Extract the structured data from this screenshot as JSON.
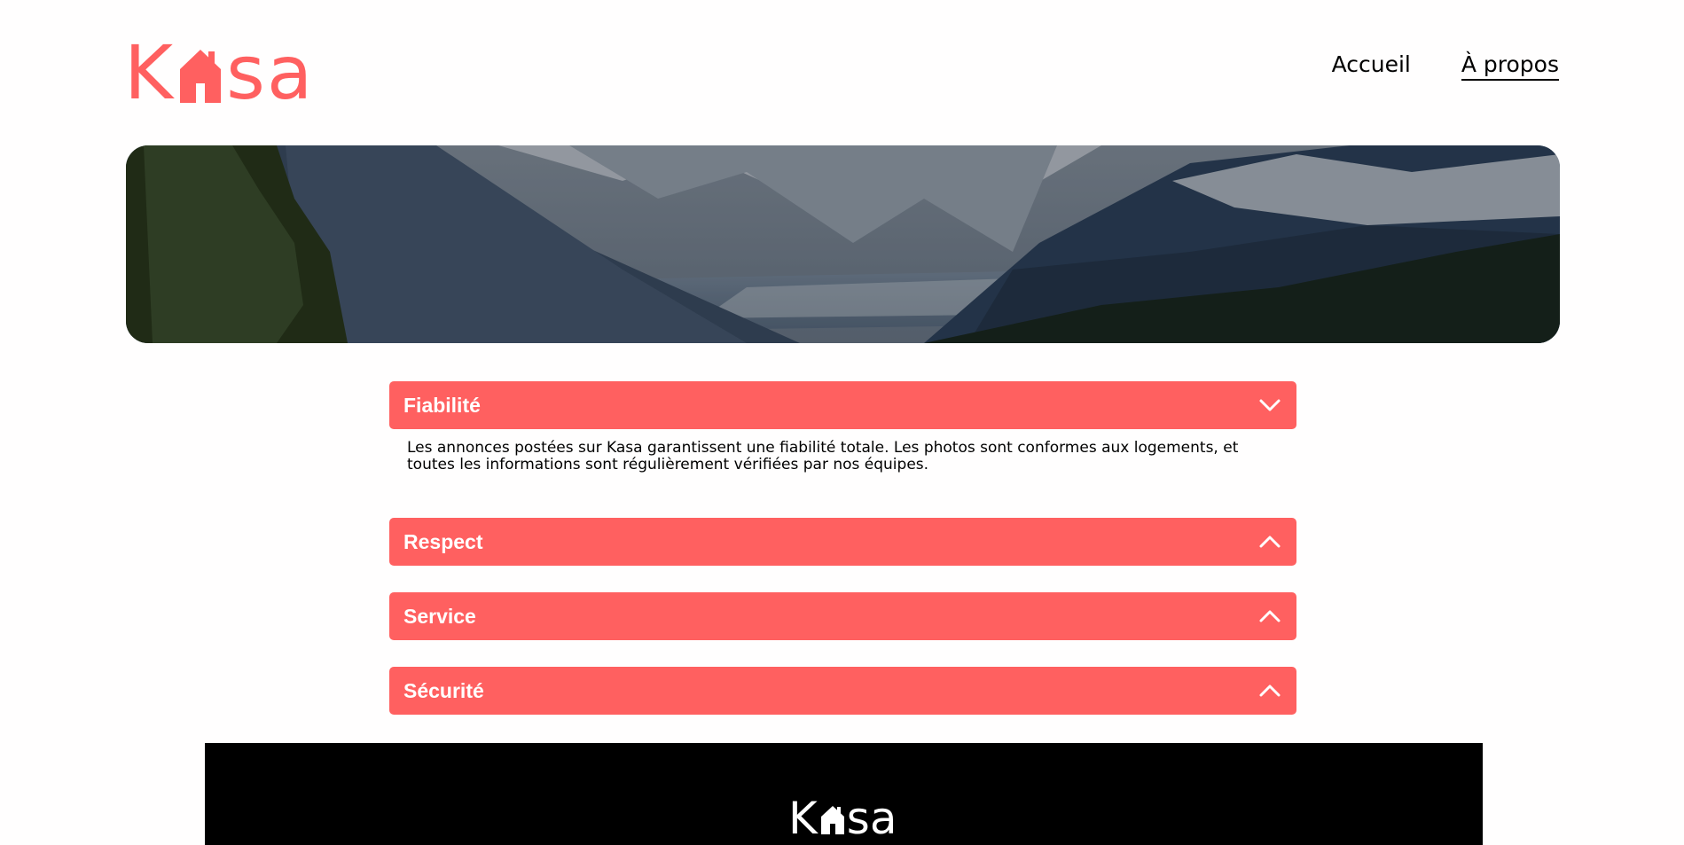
{
  "brand": {
    "logo_text": "Kasa",
    "logo_prefix": "K",
    "logo_suffix": "sa",
    "color": "#FF6060"
  },
  "nav": {
    "items": [
      {
        "label": "Accueil"
      },
      {
        "label": "À propos"
      }
    ]
  },
  "banner": {
    "icon": "mountain-landscape-image"
  },
  "collapses": [
    {
      "title": "Fiabilité",
      "open": true,
      "icon": "chevron-down-icon",
      "text": "Les annonces postées sur Kasa garantissent une fiabilité totale. Les photos sont conformes aux logements, et toutes les informations sont régulièrement vérifiées par nos équipes."
    },
    {
      "title": "Respect",
      "open": false,
      "icon": "chevron-up-icon"
    },
    {
      "title": "Service",
      "open": false,
      "icon": "chevron-up-icon"
    },
    {
      "title": "Sécurité",
      "open": false,
      "icon": "chevron-up-icon"
    }
  ],
  "footer": {
    "logo_text": "Kasa",
    "logo_prefix": "K",
    "logo_suffix": "sa",
    "color": "#000000"
  }
}
